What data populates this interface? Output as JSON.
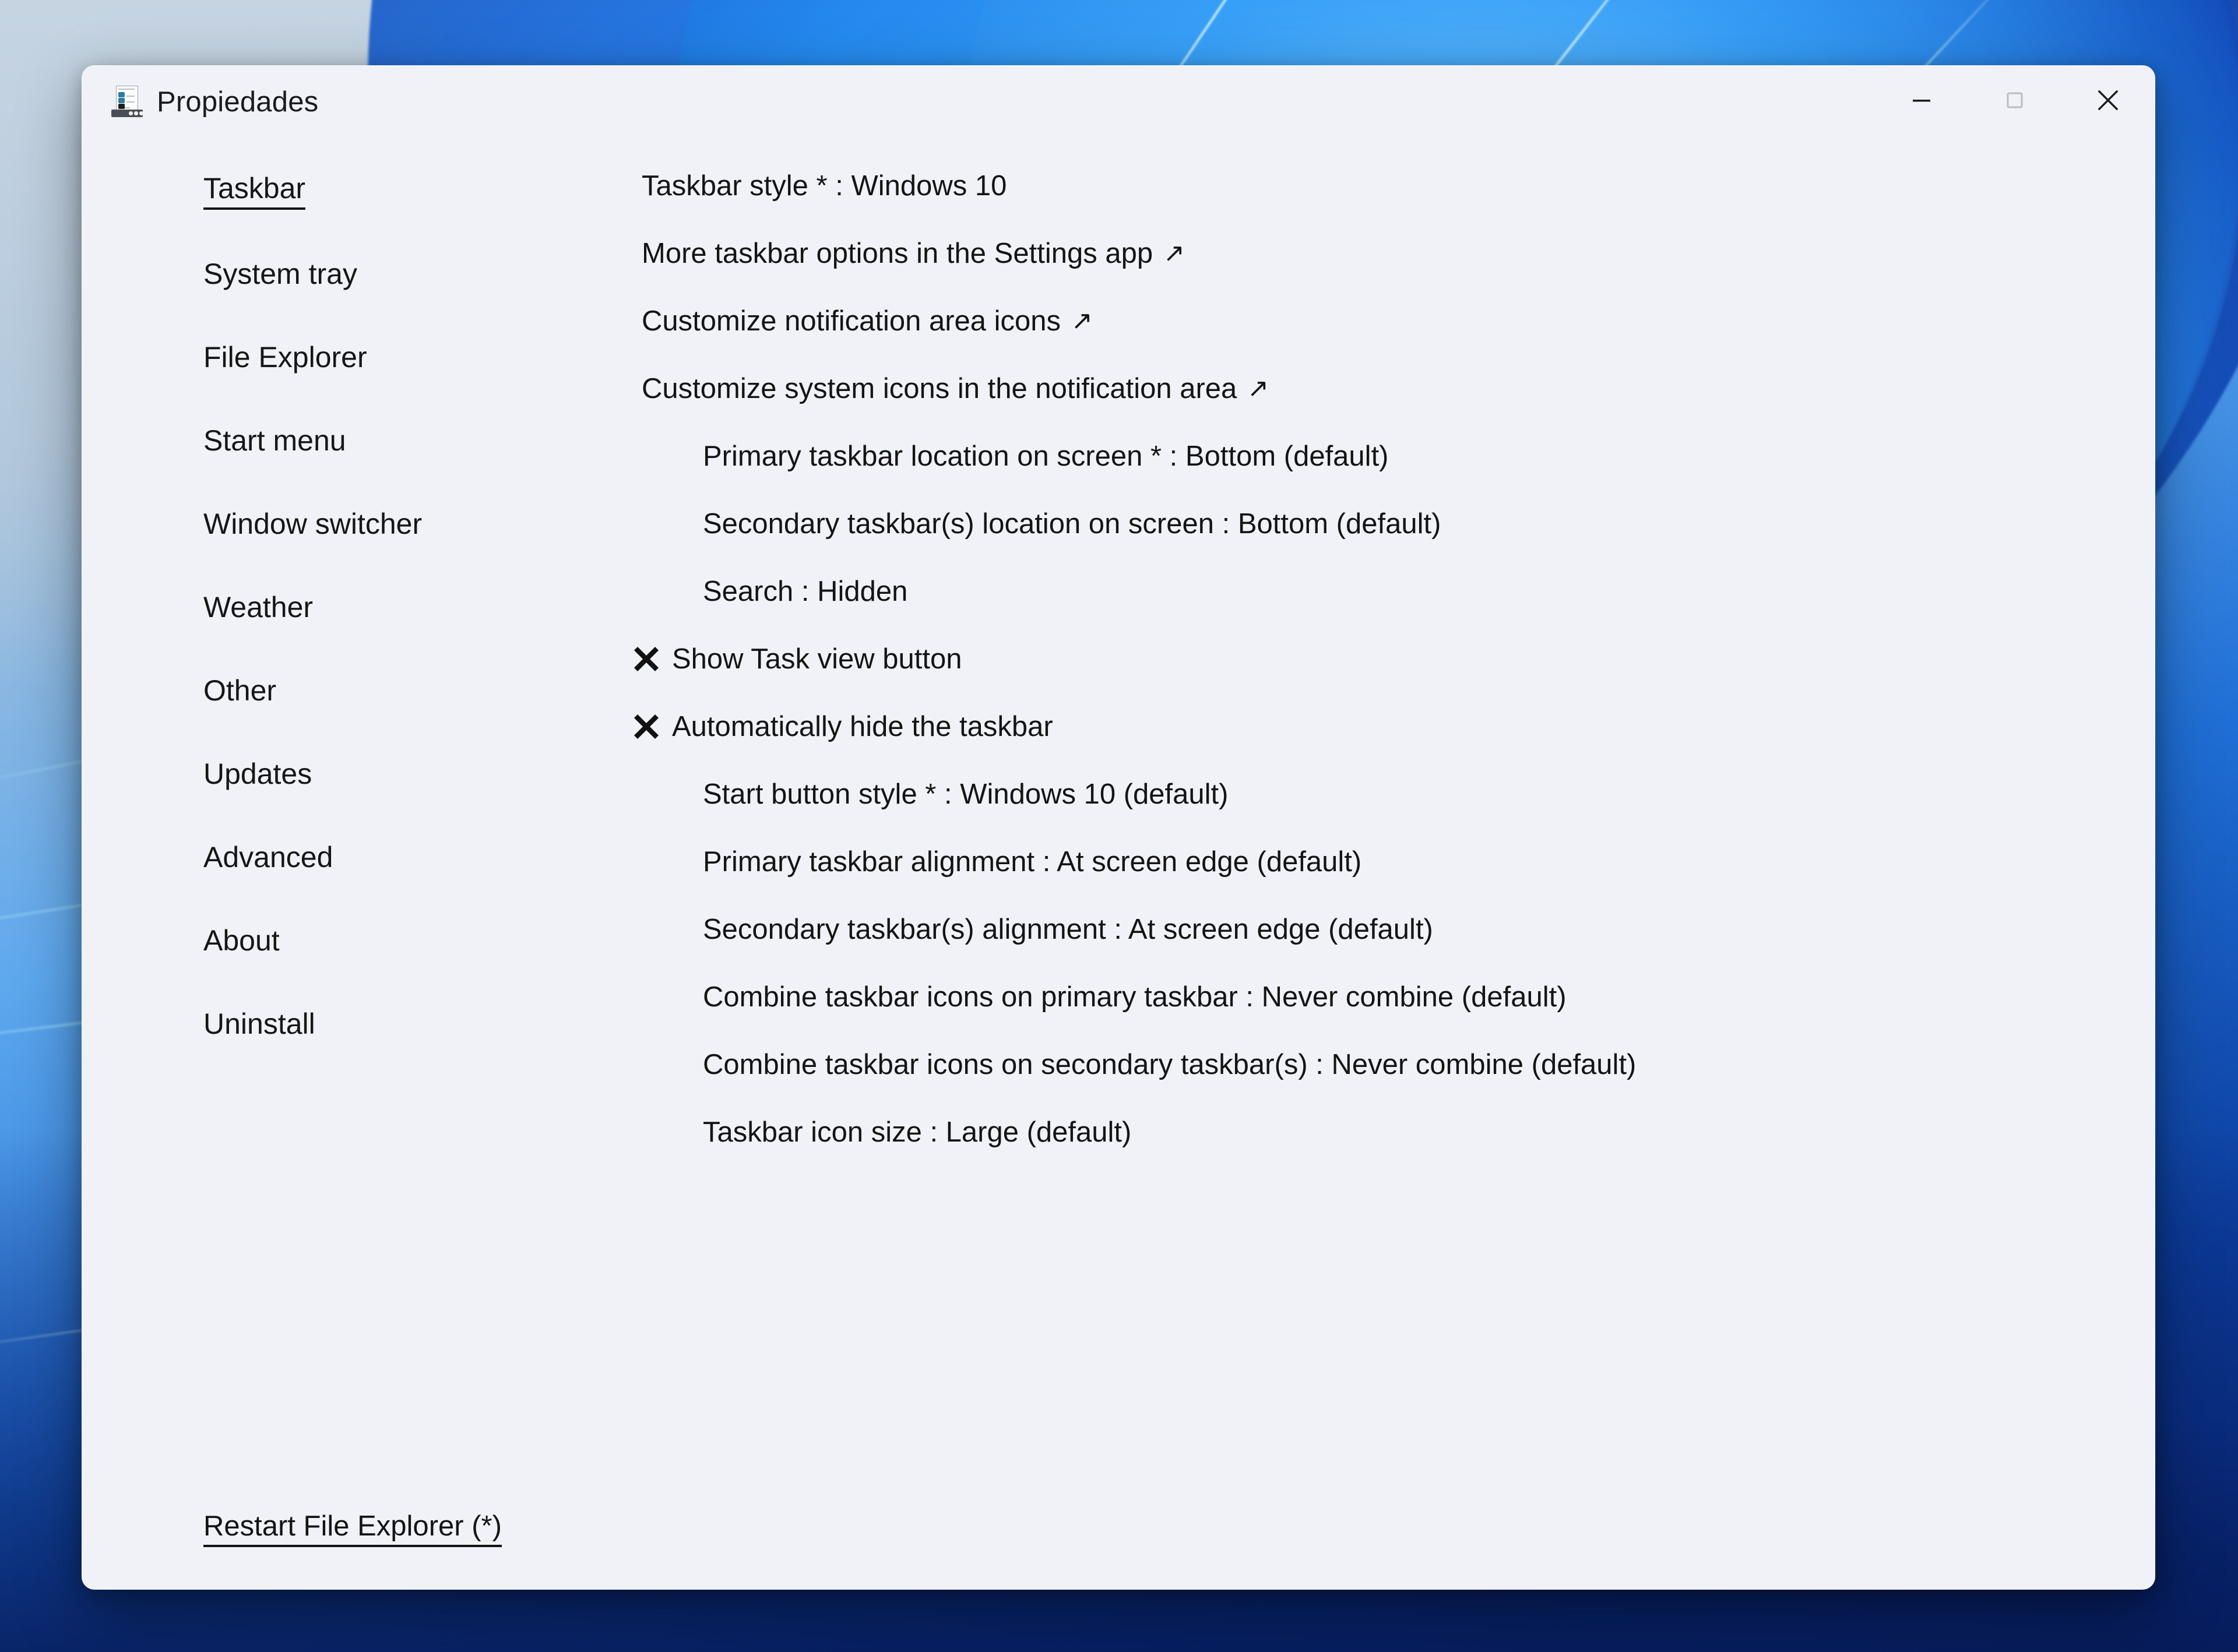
{
  "window": {
    "title": "Propiedades",
    "icon": "properties-taskbar-icon",
    "background_color": "#f0f2f7",
    "controls": {
      "minimize_label": "Minimize",
      "maximize_label": "Maximize",
      "close_label": "Close"
    }
  },
  "sidebar": {
    "items": [
      {
        "label": "Taskbar",
        "active": true
      },
      {
        "label": "System tray",
        "active": false
      },
      {
        "label": "File Explorer",
        "active": false
      },
      {
        "label": "Start menu",
        "active": false
      },
      {
        "label": "Window switcher",
        "active": false
      },
      {
        "label": "Weather",
        "active": false
      },
      {
        "label": "Other",
        "active": false
      },
      {
        "label": "Updates",
        "active": false
      },
      {
        "label": "Advanced",
        "active": false
      },
      {
        "label": "About",
        "active": false
      },
      {
        "label": "Uninstall",
        "active": false
      }
    ]
  },
  "content": {
    "rows": [
      {
        "text": "Taskbar style * : Windows 10",
        "indent": 0,
        "external": false,
        "checkbox": null
      },
      {
        "text": "More taskbar options in the Settings app",
        "indent": 0,
        "external": true,
        "checkbox": null
      },
      {
        "text": "Customize notification area icons",
        "indent": 0,
        "external": true,
        "checkbox": null
      },
      {
        "text": "Customize system icons in the notification area",
        "indent": 0,
        "external": true,
        "checkbox": null
      },
      {
        "text": "Primary taskbar location on screen * : Bottom (default)",
        "indent": 1,
        "external": false,
        "checkbox": null
      },
      {
        "text": "Secondary taskbar(s) location on screen : Bottom (default)",
        "indent": 1,
        "external": false,
        "checkbox": null
      },
      {
        "text": "Search : Hidden",
        "indent": 1,
        "external": false,
        "checkbox": null
      },
      {
        "text": "Show Task view button",
        "indent": 1,
        "external": false,
        "checkbox": "x"
      },
      {
        "text": "Automatically hide the taskbar",
        "indent": 1,
        "external": false,
        "checkbox": "x"
      },
      {
        "text": "Start button style * : Windows 10 (default)",
        "indent": 1,
        "external": false,
        "checkbox": null
      },
      {
        "text": "Primary taskbar alignment : At screen edge (default)",
        "indent": 1,
        "external": false,
        "checkbox": null
      },
      {
        "text": "Secondary taskbar(s) alignment : At screen edge (default)",
        "indent": 1,
        "external": false,
        "checkbox": null
      },
      {
        "text": "Combine taskbar icons on primary taskbar : Never combine (default)",
        "indent": 1,
        "external": false,
        "checkbox": null
      },
      {
        "text": "Combine taskbar icons on secondary taskbar(s) : Never combine (default)",
        "indent": 1,
        "external": false,
        "checkbox": null
      },
      {
        "text": "Taskbar icon size : Large (default)",
        "indent": 1,
        "external": false,
        "checkbox": null
      }
    ],
    "external_arrow_glyph": "↗"
  },
  "footer": {
    "restart_link": "Restart File Explorer (*)"
  }
}
